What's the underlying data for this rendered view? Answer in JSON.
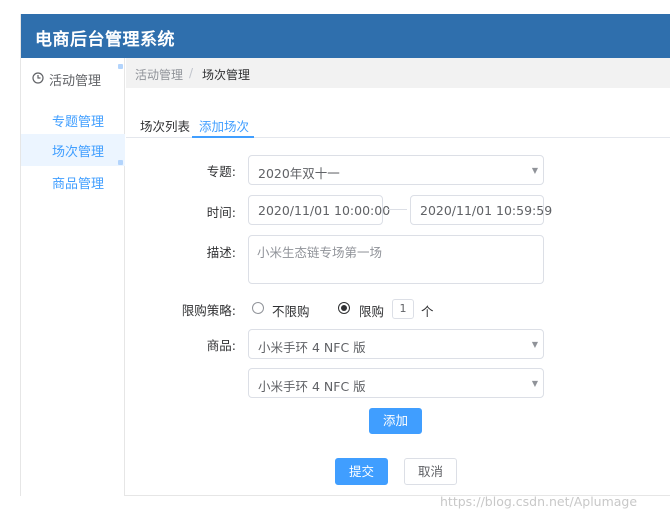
{
  "header": {
    "title": "电商后台管理系统"
  },
  "sidebar": {
    "group": {
      "label": "活动管理",
      "icon": "clock-icon"
    },
    "items": [
      {
        "label": "专题管理",
        "active": false
      },
      {
        "label": "场次管理",
        "active": true
      },
      {
        "label": "商品管理",
        "active": false
      }
    ]
  },
  "breadcrumb": {
    "items": [
      "活动管理",
      "场次管理"
    ],
    "separator": "/"
  },
  "tabs": [
    {
      "label": "场次列表",
      "active": false
    },
    {
      "label": "添加场次",
      "active": true
    }
  ],
  "form": {
    "topic": {
      "label": "专题:",
      "value": "2020年双十一"
    },
    "time": {
      "label": "时间:",
      "start": "2020/11/01 10:00:00",
      "end": "2020/11/01 10:59:59"
    },
    "description": {
      "label": "描述:",
      "value": "小米生态链专场第一场"
    },
    "limit": {
      "label": "限购策略:",
      "options": [
        "不限购",
        "限购"
      ],
      "selected": "限购",
      "quantity": "1",
      "unit": "个"
    },
    "products": {
      "label": "商品:",
      "values": [
        "小米手环 4 NFC 版",
        "小米手环 4 NFC 版"
      ]
    },
    "add_button": "添加",
    "submit_button": "提交",
    "cancel_button": "取消"
  },
  "colors": {
    "header": "#2f6fad",
    "accent": "#409eff"
  },
  "watermark": "https://blog.csdn.net/Aplumage"
}
